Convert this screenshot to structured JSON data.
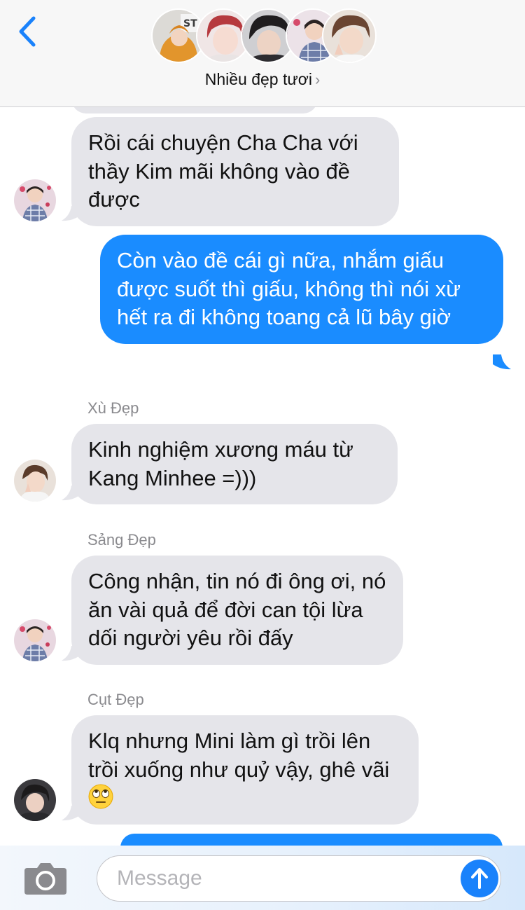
{
  "header": {
    "back_icon": "chevron-left-icon",
    "group_name": "Nhiều đẹp tươi",
    "chevron": "›",
    "participant_count": 5
  },
  "messages": [
    {
      "id": "m1",
      "direction": "incoming",
      "sender": "",
      "text": "Rồi cái chuyện Cha Cha với thầy Kim mãi không vào đề được"
    },
    {
      "id": "m2",
      "direction": "outgoing",
      "sender": "",
      "text": "Còn vào đề cái gì nữa, nhắm giấu được suốt thì giấu, không thì nói xừ hết ra đi không toang cả lũ bây giờ"
    },
    {
      "id": "m3",
      "direction": "incoming",
      "sender": "Xù Đẹp",
      "text": "Kinh nghiệm xương máu từ Kang Minhee =)))"
    },
    {
      "id": "m4",
      "direction": "incoming",
      "sender": "Sảng Đẹp",
      "text": "Công nhận, tin nó đi ông ơi, nó ăn vài quả để đời can tội lừa dối người yêu rồi đấy"
    },
    {
      "id": "m5",
      "direction": "incoming",
      "sender": "Cụt Đẹp",
      "text": "Klq nhưng Mini làm gì trồi lên trồi xuống như quỷ vậy, ghê vãi",
      "emoji": "face-with-rolling-eyes-icon"
    }
  ],
  "composer": {
    "placeholder": "Message",
    "value": "",
    "camera_icon": "camera-icon",
    "send_icon": "arrow-up-icon"
  },
  "colors": {
    "outgoing_bubble": "#1a8cff",
    "incoming_bubble": "#e5e5ea",
    "accent": "#1a82fb",
    "header_bg": "#f7f7f7"
  }
}
